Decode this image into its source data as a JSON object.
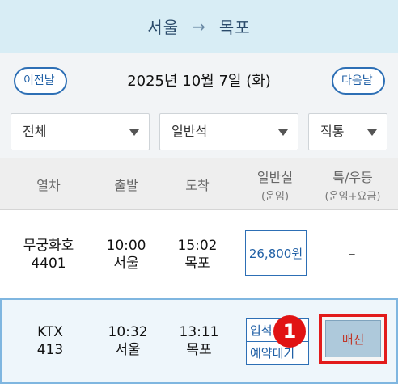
{
  "route": {
    "origin": "서울",
    "arrow": "→",
    "destination": "목포"
  },
  "date_bar": {
    "prev_label": "이전날",
    "date": "2025년 10월 7일 (화)",
    "next_label": "다음날"
  },
  "filters": {
    "train_type": "전체",
    "seat_class": "일반석",
    "route_type": "직통"
  },
  "columns": {
    "train": "열차",
    "depart": "출발",
    "arrive": "도착",
    "general": "일반실",
    "general_sub": "(운임)",
    "special": "특/우등",
    "special_sub": "(운임+요금)"
  },
  "trains": [
    {
      "name": "무궁화호",
      "number": "4401",
      "depart_time": "10:00",
      "depart_station": "서울",
      "arrive_time": "15:02",
      "arrive_station": "목포",
      "general_price": "26,800원",
      "special": "–"
    },
    {
      "name": "KTX",
      "number": "413",
      "depart_time": "10:32",
      "depart_station": "서울",
      "arrive_time": "13:11",
      "arrive_station": "목포",
      "general_standing": "입석+좌석",
      "general_reserve": "예약대기",
      "special": "매진"
    }
  ],
  "annotation": {
    "step_number": "1",
    "highlight_color": "#e21b1b"
  }
}
